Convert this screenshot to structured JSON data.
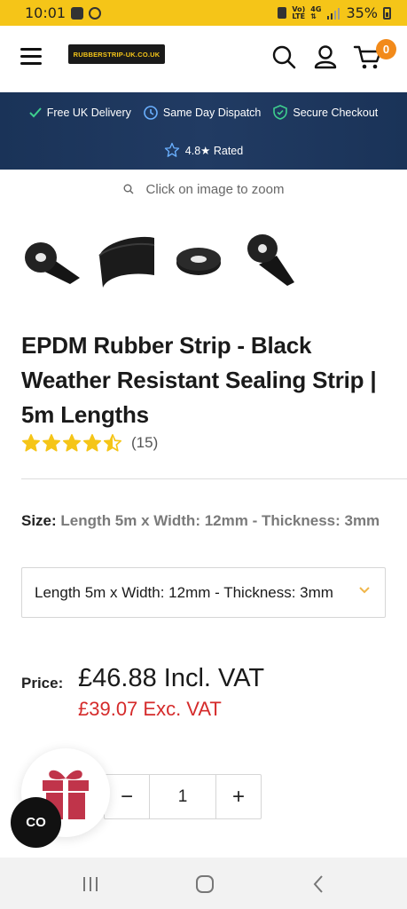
{
  "status_bar": {
    "time": "10:01",
    "battery": "35%",
    "net_small_1": "Vo)",
    "net_small_2": "LTE",
    "net_4g": "4G"
  },
  "header": {
    "logo_text": "RUBBERSTRIP-UK.CO.UK",
    "cart_count": "0"
  },
  "promo": {
    "items": [
      {
        "label": "Free UK Delivery",
        "icon": "check-icon"
      },
      {
        "label": "Same Day Dispatch",
        "icon": "clock-icon"
      },
      {
        "label": "Secure Checkout",
        "icon": "shield-check-icon"
      }
    ],
    "rated": "4.8★ Rated"
  },
  "product": {
    "zoom_hint": "Click on image to zoom",
    "title": "EPDM Rubber Strip - Black Weather Resistant Sealing Strip | 5m Lengths",
    "rating_value": 4.5,
    "rating_count": "(15)",
    "size_label": "Size:",
    "size_value": "Length 5m x Width: 12mm - Thickness: 3mm",
    "select_value": "Length 5m x Width: 12mm - Thickness: 3mm",
    "price_label": "Price:",
    "price_incl": "£46.88 Incl. VAT",
    "price_exc": "£39.07 Exc. VAT",
    "quantity": "1",
    "qty_minus": "−",
    "qty_plus": "+"
  },
  "widgets": {
    "co_label": "CO"
  },
  "colors": {
    "status_bar": "#f5c518",
    "promo_bg": "#1a3358",
    "accent_green": "#3ecf8e",
    "cart_badge": "#f28a1a",
    "price_exc": "#d52b2b",
    "star": "#f5c518",
    "gift": "#c0344a"
  }
}
